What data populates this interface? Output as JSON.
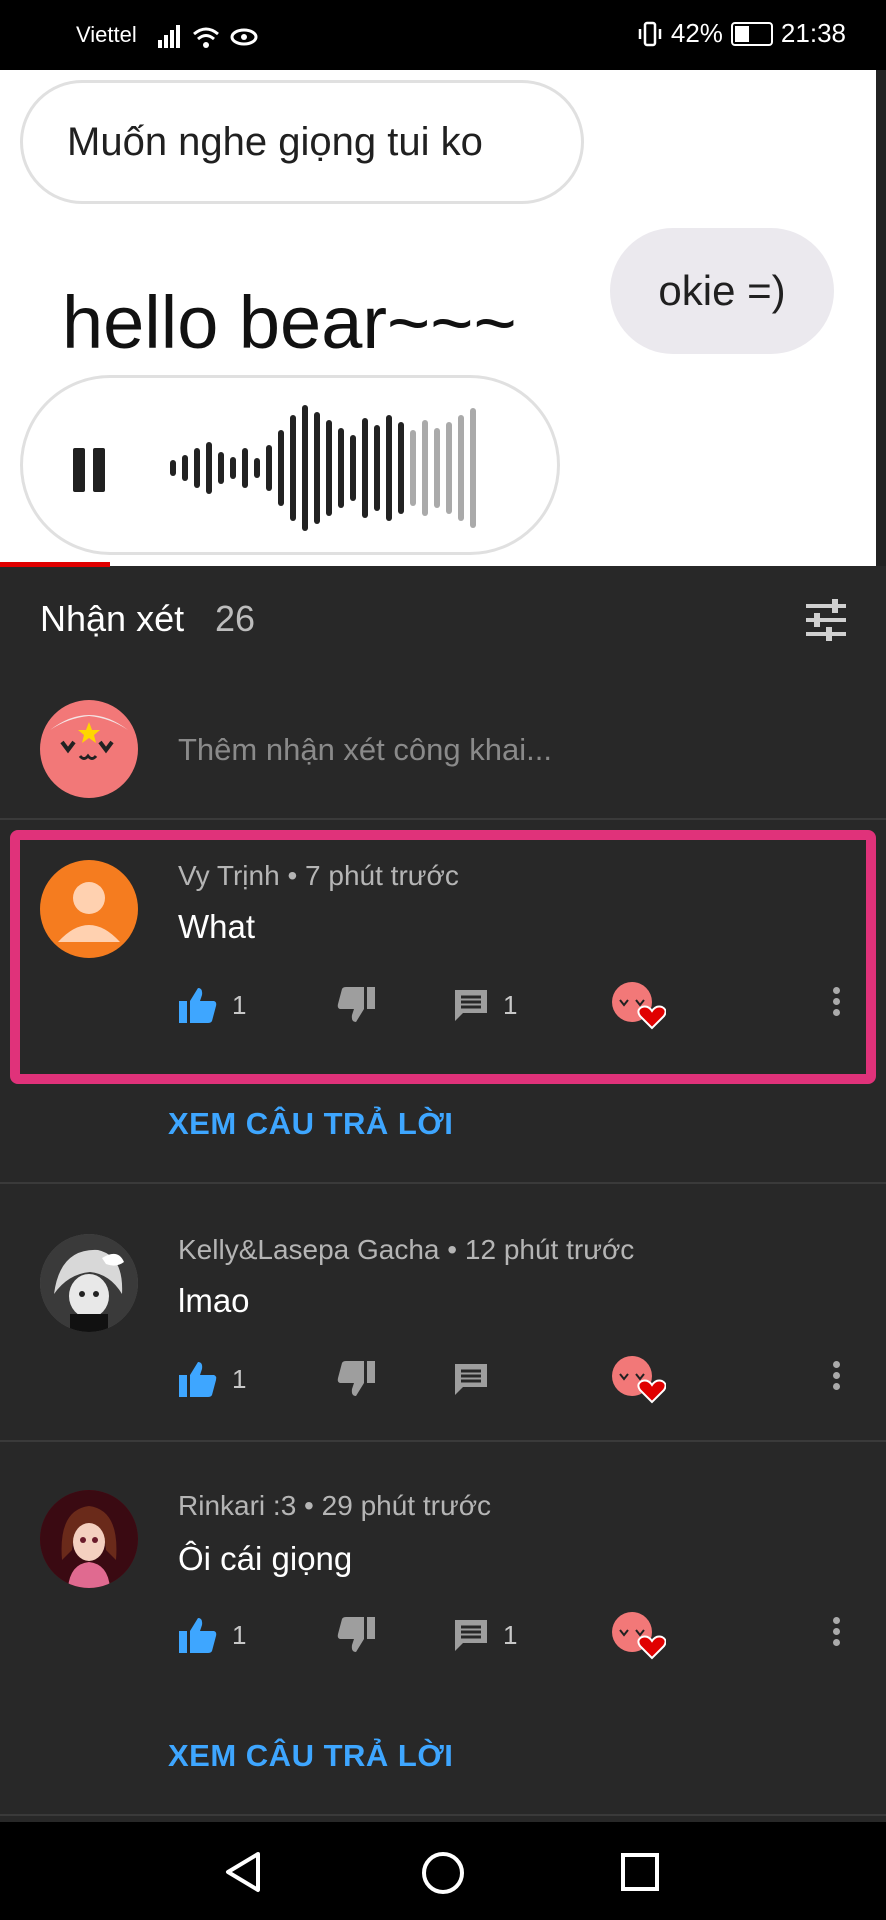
{
  "status_bar": {
    "carrier": "Viettel",
    "battery": "42%",
    "time": "21:38"
  },
  "video": {
    "bubble_top": "Muốn nghe giọng tui ko",
    "bubble_reply": "okie =)",
    "caption": "hello bear~~~"
  },
  "comments": {
    "title": "Nhận xét",
    "count": "26",
    "add_placeholder": "Thêm nhận xét công khai...",
    "view_replies_label": "XEM CÂU TRẢ LỜI",
    "items": [
      {
        "author": "Vy Trịnh",
        "time": "7 phút trước",
        "text": "What",
        "likes": "1",
        "replies": "1",
        "avatar_color": "#f57c1f"
      },
      {
        "author": "Kelly&Lasepa Gacha",
        "time": "12 phút trước",
        "text": "lmao",
        "likes": "1",
        "replies": "",
        "avatar_color": "#555555"
      },
      {
        "author": "Rinkari :3",
        "time": "29 phút trước",
        "text": "Ôi cái giọng",
        "likes": "1",
        "replies": "1",
        "avatar_color": "#5a0f1a"
      }
    ]
  },
  "colors": {
    "accent_link": "#3ea6ff",
    "highlight_border": "#e0327a",
    "like_blue": "#3ea6ff"
  },
  "icons": [
    "filter-icon",
    "thumbs-up-icon",
    "thumbs-down-icon",
    "reply-icon",
    "creator-heart-icon",
    "more-vert-icon",
    "back-icon",
    "home-icon",
    "recents-icon"
  ]
}
